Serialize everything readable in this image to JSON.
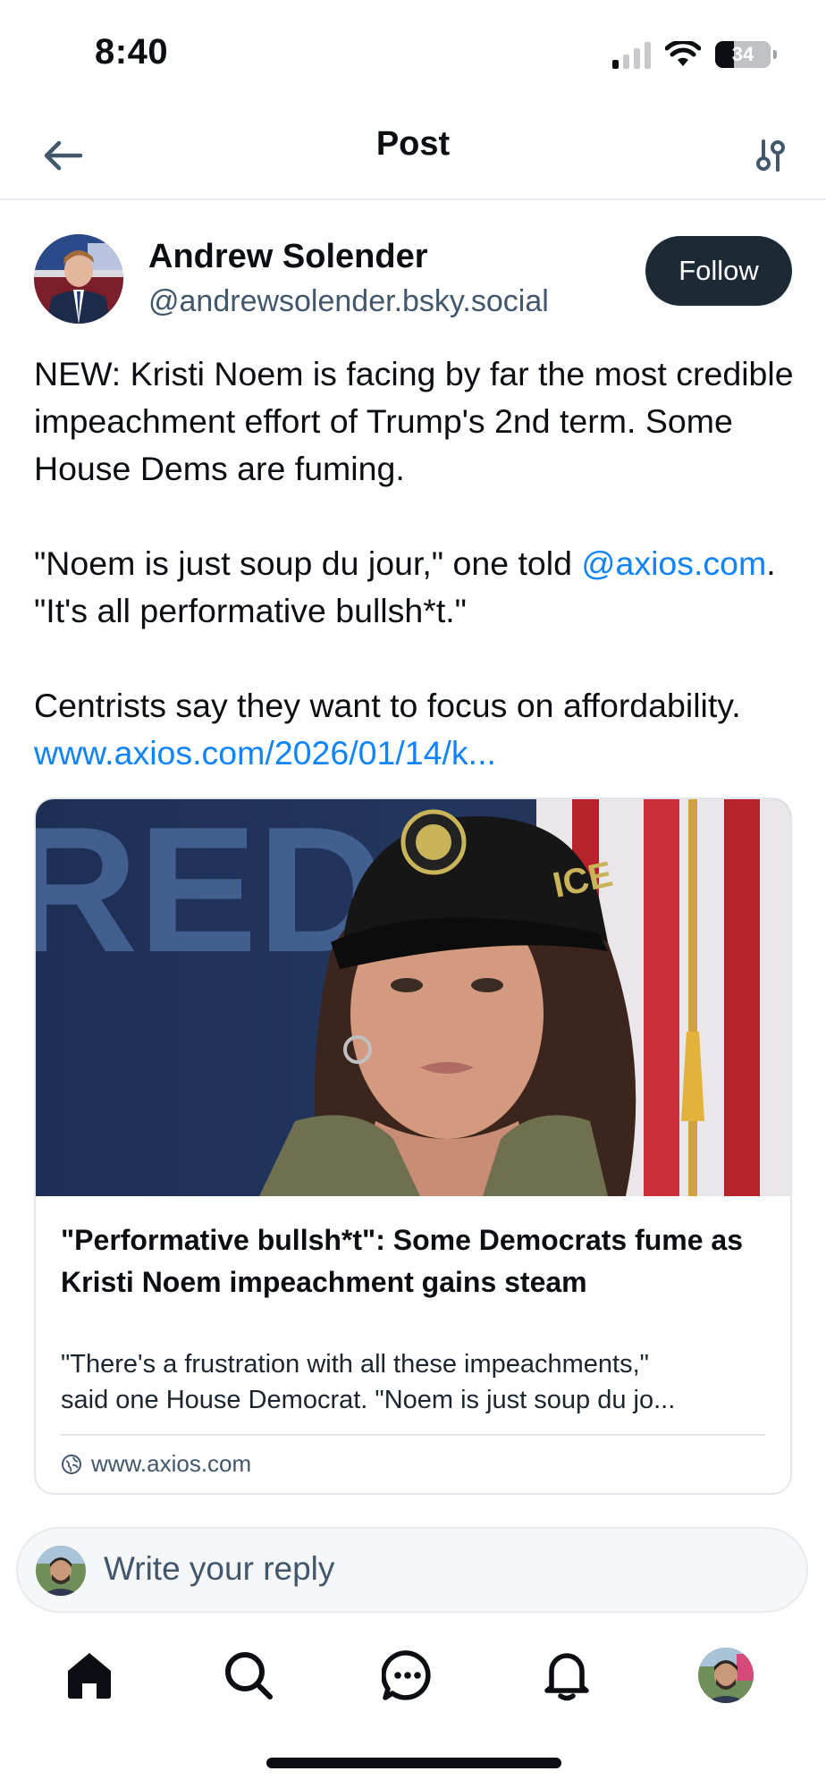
{
  "status_bar": {
    "time": "8:40",
    "battery_level": "34",
    "icons": [
      "cellular-signal-icon",
      "wifi-icon",
      "battery-icon"
    ]
  },
  "header": {
    "title": "Post",
    "back_icon": "arrow-left-icon",
    "settings_icon": "sliders-icon"
  },
  "author": {
    "name": "Andrew Solender",
    "handle": "@andrewsolender.bsky.social",
    "follow_label": "Follow"
  },
  "post": {
    "para1": "NEW: Kristi Noem is facing by far the most credible impeachment effort of Trump's 2nd term. Some House Dems are fuming.",
    "para2_before": "\"Noem is just soup du jour,\" one told ",
    "para2_mention": "@axios.com",
    "para2_after": ". \"It's all performative bullsh*t.\"",
    "para3_before": "Centrists say they want to focus on affordability. ",
    "para3_link": "www.axios.com/2026/01/14/k..."
  },
  "link_card": {
    "image_text": "RED",
    "title": "\"Performative bullsh*t\": Some Democrats fume as Kristi Noem impeachment gains steam",
    "description_line1": "\"There's a frustration with all these impeachments,\"",
    "description_line2": "said one House Democrat. \"Noem is just soup du jo...",
    "domain": "www.axios.com"
  },
  "reply": {
    "placeholder": "Write your reply"
  },
  "bottom_nav": {
    "items": [
      "home-icon",
      "search-icon",
      "chat-icon",
      "bell-icon",
      "profile-avatar"
    ]
  },
  "colors": {
    "link": "#1083fe",
    "follow_button": "#1e2936",
    "secondary_text": "#42576c"
  }
}
